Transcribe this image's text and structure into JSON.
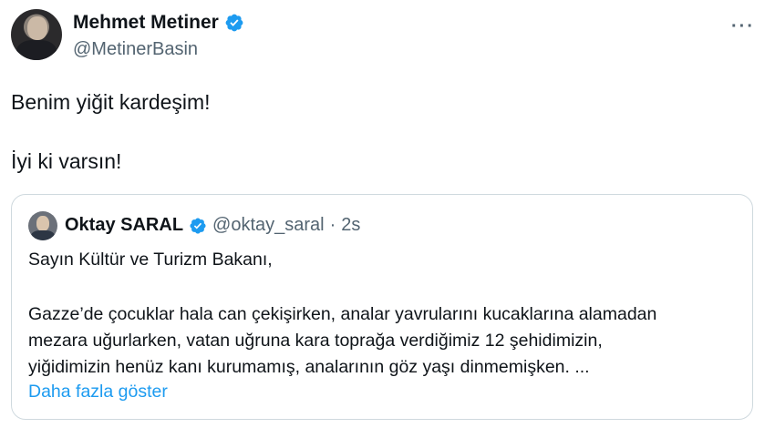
{
  "author": {
    "name": "Mehmet Metiner",
    "handle": "@MetinerBasin",
    "verified_color": "#1d9bf0"
  },
  "menu": {
    "more_label": "···"
  },
  "tweet": {
    "lines": [
      "Benim yiğit kardeşim!",
      "İyi ki varsın!"
    ]
  },
  "quote": {
    "name": "Oktay SARAL",
    "handle": "@oktay_saral",
    "separator": "·",
    "time": "2s",
    "lines": [
      "Sayın Kültür ve Turizm Bakanı,",
      "Gazze’de çocuklar hala can çekişirken, analar yavrularını kucaklarına alamadan",
      "mezara uğurlarken, vatan uğruna kara toprağa verdiğimiz 12 şehidimizin,",
      "yiğidimizin henüz kanı kurumamış, analarının göz yaşı dinmemişken. ..."
    ],
    "show_more": "Daha fazla göster"
  }
}
